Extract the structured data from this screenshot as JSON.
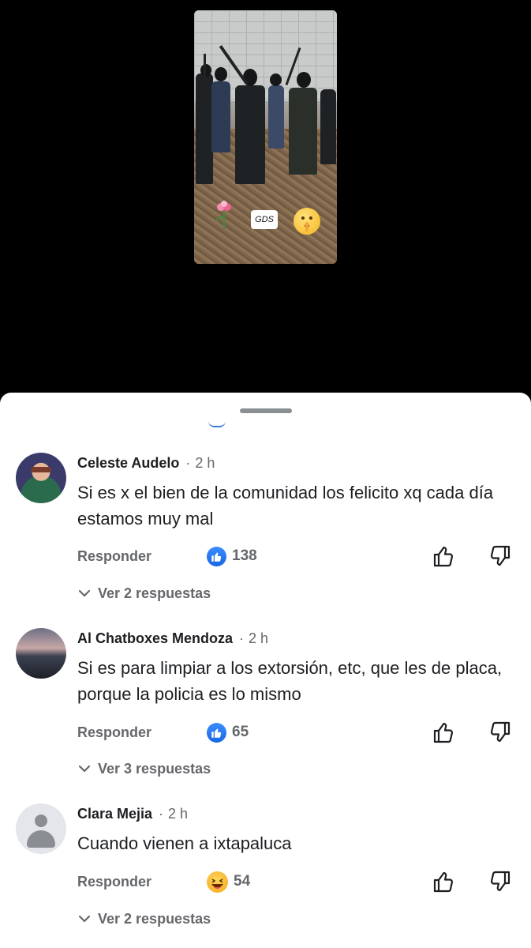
{
  "video": {
    "sticker_text": "GDS",
    "flower_icon": "flower-icon",
    "shush_icon": "shushing-face-icon"
  },
  "comments": [
    {
      "author": "Celeste Audelo",
      "time": "2 h",
      "text": "Si es x el bien de la comunidad los  felicito xq cada día estamos muy mal",
      "reply_label": "Responder",
      "reaction_icon": "like-icon",
      "reaction_count": "138",
      "replies_label": "Ver 2 respuestas"
    },
    {
      "author": "Al Chatboxes Mendoza",
      "time": "2 h",
      "text": "Si es para limpiar a los extorsión, etc, que les de placa, porque la policia es lo mismo",
      "reply_label": "Responder",
      "reaction_icon": "like-icon",
      "reaction_count": "65",
      "replies_label": "Ver 3 respuestas"
    },
    {
      "author": "Clara Mejia",
      "time": "2 h",
      "text": "Cuando vienen a ixtapaluca",
      "reply_label": "Responder",
      "reaction_icon": "haha-icon",
      "reaction_count": "54",
      "replies_label": "Ver 2 respuestas"
    }
  ],
  "colors": {
    "like_blue": "#1877f2",
    "secondary_text": "#65676b",
    "primary_text": "#1c1e21"
  }
}
